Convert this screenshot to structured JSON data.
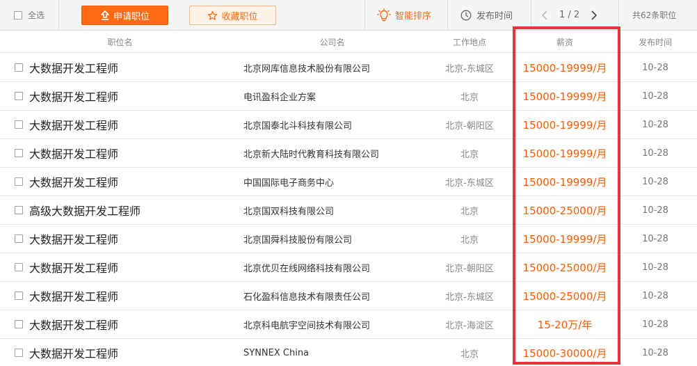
{
  "toolbar": {
    "select_all_label": "全选",
    "apply_label": "申请职位",
    "favorite_label": "收藏职位",
    "smart_sort_label": "智能排序",
    "time_sort_label": "发布时间",
    "page_indicator": "1 / 2",
    "total_label": "共62条职位"
  },
  "columns": {
    "title": "职位名",
    "company": "公司名",
    "location": "工作地点",
    "salary": "薪资",
    "date": "发布时间"
  },
  "jobs": [
    {
      "title": "大数据开发工程师",
      "company": "北京网库信息技术股份有限公司",
      "location": "北京-东城区",
      "salary": "15000-19999/月",
      "date": "10-28"
    },
    {
      "title": "大数据开发工程师",
      "company": "电讯盈科企业方案",
      "location": "北京",
      "salary": "15000-19999/月",
      "date": "10-28"
    },
    {
      "title": "大数据开发工程师",
      "company": "北京国泰北斗科技有限公司",
      "location": "北京-朝阳区",
      "salary": "15000-19999/月",
      "date": "10-28"
    },
    {
      "title": "大数据开发工程师",
      "company": "北京新大陆时代教育科技有限公司",
      "location": "北京",
      "salary": "15000-19999/月",
      "date": "10-28"
    },
    {
      "title": "大数据开发工程师",
      "company": "中国国际电子商务中心",
      "location": "北京-东城区",
      "salary": "15000-19999/月",
      "date": "10-28"
    },
    {
      "title": "高级大数据开发工程师",
      "company": "北京国双科技有限公司",
      "location": "北京",
      "salary": "15000-25000/月",
      "date": "10-28"
    },
    {
      "title": "大数据开发工程师",
      "company": "北京国舜科技股份有限公司",
      "location": "北京",
      "salary": "15000-19999/月",
      "date": "10-28"
    },
    {
      "title": "大数据开发工程师",
      "company": "北京优贝在线网络科技有限公司",
      "location": "北京-朝阳区",
      "salary": "15000-25000/月",
      "date": "10-28"
    },
    {
      "title": "大数据开发工程师",
      "company": "石化盈科信息技术有限责任公司",
      "location": "北京-东城区",
      "salary": "15000-25000/月",
      "date": "10-28"
    },
    {
      "title": "大数据开发工程师",
      "company": "北京科电航宇空间技术有限公司",
      "location": "北京-海淀区",
      "salary": "15-20万/年",
      "date": "10-28"
    },
    {
      "title": "大数据开发工程师",
      "company": "SYNNEX China",
      "location": "北京",
      "salary": "15000-30000/月",
      "date": "10-28"
    }
  ],
  "colors": {
    "accent": "#ff6a13",
    "salary": "#ff5a00",
    "highlight": "#e8333c"
  }
}
